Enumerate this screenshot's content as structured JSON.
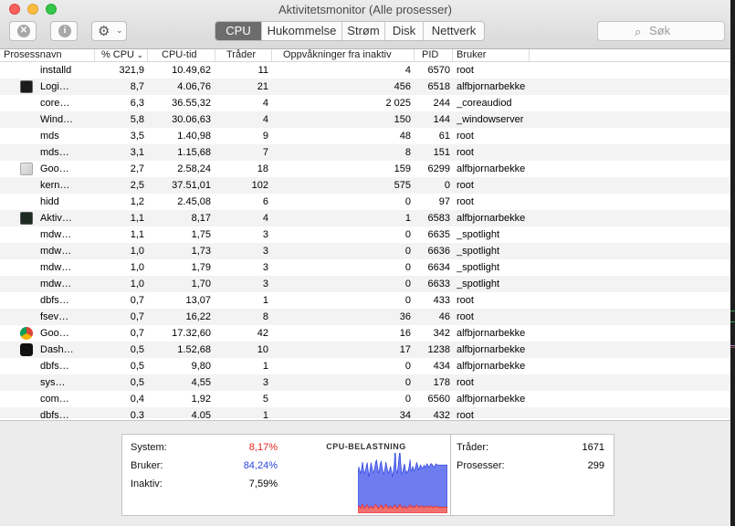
{
  "window": {
    "title": "Aktivitetsmonitor (Alle prosesser)"
  },
  "toolbar": {
    "stop_glyph": "✕",
    "info_glyph": "i",
    "gear_glyph": "⚙",
    "chevron_glyph": "⌄",
    "tabs": [
      "CPU",
      "Hukommelse",
      "Strøm",
      "Disk",
      "Nettverk"
    ],
    "active_tab": "CPU",
    "search_placeholder": "Søk"
  },
  "table": {
    "columns": [
      "Prosessnavn",
      "% CPU",
      "CPU-tid",
      "Tråder",
      "Oppvåkninger fra inaktiv",
      "PID",
      "Bruker"
    ],
    "sort_indicator": "⌄",
    "rows": [
      {
        "name": "installd",
        "cpu": "321,9",
        "time": "10.49,62",
        "threads": "11",
        "wakeups": "4",
        "pid": "6570",
        "user": "root",
        "icon": ""
      },
      {
        "name": "Logi…",
        "cpu": "8,7",
        "time": "4.06,76",
        "threads": "21",
        "wakeups": "456",
        "pid": "6518",
        "user": "alfbjornarbekke",
        "icon": "logitech-icon"
      },
      {
        "name": "core…",
        "cpu": "6,3",
        "time": "36.55,32",
        "threads": "4",
        "wakeups": "2 025",
        "pid": "244",
        "user": "_coreaudiod",
        "icon": ""
      },
      {
        "name": "Wind…",
        "cpu": "5,8",
        "time": "30.06,63",
        "threads": "4",
        "wakeups": "150",
        "pid": "144",
        "user": "_windowserver",
        "icon": ""
      },
      {
        "name": "mds",
        "cpu": "3,5",
        "time": "1.40,98",
        "threads": "9",
        "wakeups": "48",
        "pid": "61",
        "user": "root",
        "icon": ""
      },
      {
        "name": "mds…",
        "cpu": "3,1",
        "time": "1.15,68",
        "threads": "7",
        "wakeups": "8",
        "pid": "151",
        "user": "root",
        "icon": ""
      },
      {
        "name": "Goo…",
        "cpu": "2,7",
        "time": "2.58,24",
        "threads": "18",
        "wakeups": "159",
        "pid": "6299",
        "user": "alfbjornarbekke",
        "icon": "google-app-icon"
      },
      {
        "name": "kern…",
        "cpu": "2,5",
        "time": "37.51,01",
        "threads": "102",
        "wakeups": "575",
        "pid": "0",
        "user": "root",
        "icon": ""
      },
      {
        "name": "hidd",
        "cpu": "1,2",
        "time": "2.45,08",
        "threads": "6",
        "wakeups": "0",
        "pid": "97",
        "user": "root",
        "icon": ""
      },
      {
        "name": "Aktiv…",
        "cpu": "1,1",
        "time": "8,17",
        "threads": "4",
        "wakeups": "1",
        "pid": "6583",
        "user": "alfbjornarbekke",
        "icon": "activity-monitor-icon"
      },
      {
        "name": "mdw…",
        "cpu": "1,1",
        "time": "1,75",
        "threads": "3",
        "wakeups": "0",
        "pid": "6635",
        "user": "_spotlight",
        "icon": ""
      },
      {
        "name": "mdw…",
        "cpu": "1,0",
        "time": "1,73",
        "threads": "3",
        "wakeups": "0",
        "pid": "6636",
        "user": "_spotlight",
        "icon": ""
      },
      {
        "name": "mdw…",
        "cpu": "1,0",
        "time": "1,79",
        "threads": "3",
        "wakeups": "0",
        "pid": "6634",
        "user": "_spotlight",
        "icon": ""
      },
      {
        "name": "mdw…",
        "cpu": "1,0",
        "time": "1,70",
        "threads": "3",
        "wakeups": "0",
        "pid": "6633",
        "user": "_spotlight",
        "icon": ""
      },
      {
        "name": "dbfs…",
        "cpu": "0,7",
        "time": "13,07",
        "threads": "1",
        "wakeups": "0",
        "pid": "433",
        "user": "root",
        "icon": ""
      },
      {
        "name": "fsev…",
        "cpu": "0,7",
        "time": "16,22",
        "threads": "8",
        "wakeups": "36",
        "pid": "46",
        "user": "root",
        "icon": ""
      },
      {
        "name": "Goo…",
        "cpu": "0,7",
        "time": "17.32,60",
        "threads": "42",
        "wakeups": "16",
        "pid": "342",
        "user": "alfbjornarbekke",
        "icon": "chrome-icon"
      },
      {
        "name": "Dash…",
        "cpu": "0,5",
        "time": "1.52,68",
        "threads": "10",
        "wakeups": "17",
        "pid": "1238",
        "user": "alfbjornarbekke",
        "icon": "dashboard-icon"
      },
      {
        "name": "dbfs…",
        "cpu": "0,5",
        "time": "9,80",
        "threads": "1",
        "wakeups": "0",
        "pid": "434",
        "user": "alfbjornarbekke",
        "icon": ""
      },
      {
        "name": "sys…",
        "cpu": "0,5",
        "time": "4,55",
        "threads": "3",
        "wakeups": "0",
        "pid": "178",
        "user": "root",
        "icon": ""
      },
      {
        "name": "com…",
        "cpu": "0,4",
        "time": "1,92",
        "threads": "5",
        "wakeups": "0",
        "pid": "6560",
        "user": "alfbjornarbekke",
        "icon": ""
      },
      {
        "name": "dbfs…",
        "cpu": "0,3",
        "time": "4,05",
        "threads": "1",
        "wakeups": "34",
        "pid": "432",
        "user": "root",
        "icon": ""
      }
    ]
  },
  "summary": {
    "system_label": "System:",
    "system_value": "8,17%",
    "user_label": "Bruker:",
    "user_value": "84,24%",
    "idle_label": "Inaktiv:",
    "idle_value": "7,59%",
    "load_title": "CPU-BELASTNING",
    "threads_label": "Tråder:",
    "threads_value": "1671",
    "processes_label": "Prosesser:",
    "processes_value": "299"
  },
  "colors": {
    "system": "#e8261f",
    "user": "#2a44e0",
    "user_fill": "#6f7cf0",
    "system_fill": "#f07070"
  },
  "load_history": {
    "user": [
      0.55,
      0.65,
      0.6,
      0.58,
      0.63,
      0.7,
      0.62,
      0.58,
      0.6,
      0.66,
      0.7,
      0.6,
      0.52,
      0.62,
      0.72,
      0.68,
      0.6,
      0.58,
      0.64,
      0.7,
      0.75,
      0.68,
      0.58,
      0.62,
      0.7,
      0.72,
      0.66,
      0.6,
      0.55,
      0.62,
      0.7,
      0.65,
      0.6,
      0.58,
      0.62,
      0.66,
      0.6,
      0.52,
      0.6,
      0.7,
      0.95,
      0.62,
      0.58,
      0.66,
      0.8,
      0.9,
      0.7,
      0.55,
      0.6,
      0.66,
      0.7,
      0.62,
      0.58,
      0.6,
      0.6,
      0.66,
      0.75,
      0.6,
      0.62,
      0.66,
      0.6,
      0.62,
      0.66,
      0.7,
      0.68,
      0.62,
      0.65,
      0.68,
      0.66,
      0.64,
      0.66,
      0.68,
      0.66,
      0.68,
      0.7,
      0.68,
      0.66,
      0.68,
      0.7,
      0.7,
      0.7,
      0.68,
      0.66,
      0.68,
      0.7,
      0.7,
      0.7,
      0.7,
      0.7,
      0.7,
      0.7,
      0.7,
      0.7,
      0.7,
      0.7,
      0.7,
      0.7
    ],
    "system": [
      0.1,
      0.12,
      0.1,
      0.08,
      0.12,
      0.15,
      0.1,
      0.08,
      0.1,
      0.12,
      0.14,
      0.1,
      0.08,
      0.1,
      0.12,
      0.1,
      0.08,
      0.1,
      0.12,
      0.15,
      0.13,
      0.1,
      0.08,
      0.1,
      0.12,
      0.14,
      0.1,
      0.08,
      0.1,
      0.12,
      0.15,
      0.12,
      0.1,
      0.08,
      0.1,
      0.12,
      0.1,
      0.08,
      0.1,
      0.12,
      0.14,
      0.1,
      0.08,
      0.1,
      0.12,
      0.15,
      0.12,
      0.1,
      0.08,
      0.1,
      0.12,
      0.1,
      0.08,
      0.1,
      0.1,
      0.12,
      0.14,
      0.1,
      0.1,
      0.12,
      0.1,
      0.1,
      0.12,
      0.14,
      0.12,
      0.1,
      0.1,
      0.12,
      0.12,
      0.1,
      0.1,
      0.12,
      0.1,
      0.1,
      0.12,
      0.12,
      0.1,
      0.1,
      0.12,
      0.12,
      0.1,
      0.1,
      0.1,
      0.12,
      0.12,
      0.1,
      0.1,
      0.1,
      0.1,
      0.1,
      0.1,
      0.1,
      0.1,
      0.1,
      0.1,
      0.1,
      0.1
    ]
  }
}
